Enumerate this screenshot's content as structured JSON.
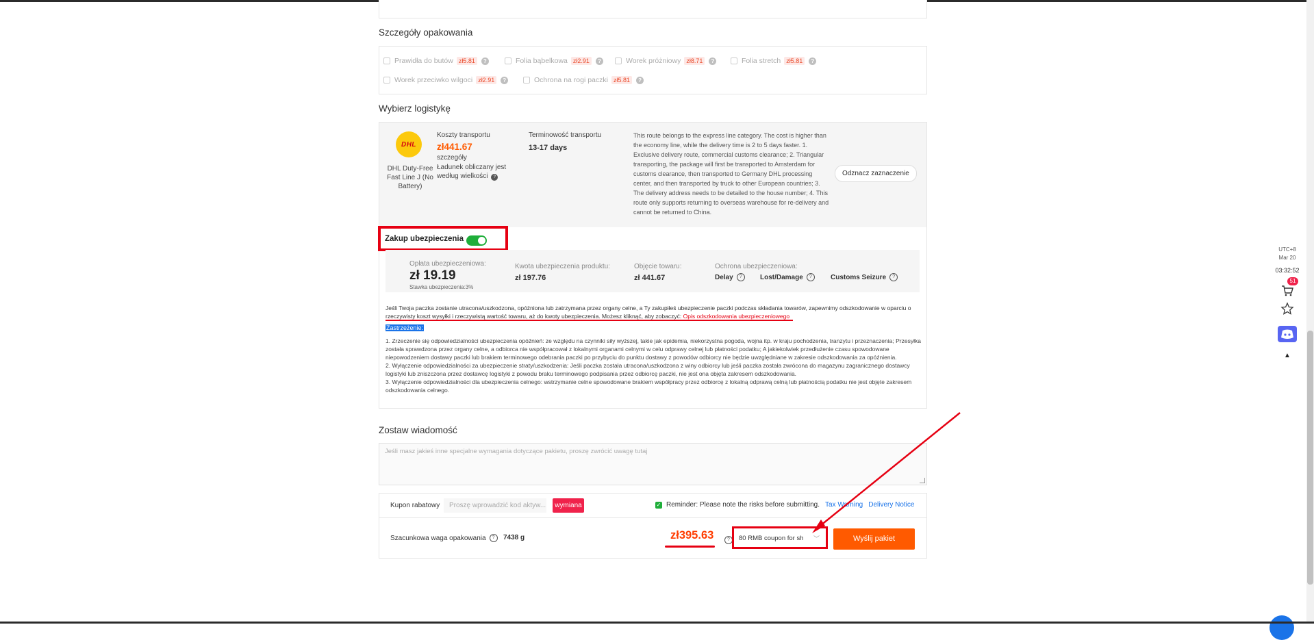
{
  "packaging": {
    "title": "Szczegóły opakowania",
    "items": [
      {
        "label": "Prawidła do butów",
        "price": "zł5.81"
      },
      {
        "label": "Folia bąbelkowa",
        "price": "zł2.91"
      },
      {
        "label": "Worek próżniowy",
        "price": "zł8.71"
      },
      {
        "label": "Folia stretch",
        "price": "zł5.81"
      },
      {
        "label": "Worek przeciwko wilgoci",
        "price": "zł2.91"
      },
      {
        "label": "Ochrona na rogi paczki",
        "price": "zł5.81"
      }
    ]
  },
  "logistics": {
    "title": "Wybierz logistykę",
    "logo_text": "DHL",
    "carrier_name": "DHL Duty-Free Fast Line J (No Battery)",
    "cost_label": "Koszty transportu",
    "cost_value": "zł441.67",
    "details_label": "szczegóły",
    "weight_note": "Ładunek obliczany jest według wielkości",
    "time_label": "Terminowość transportu",
    "time_value": "13-17 days",
    "description": "This route belongs to the express line category. The cost is higher than the economy line, while the delivery time is 2 to 5 days faster. 1. Exclusive delivery route, commercial customs clearance; 2. Triangular transporting, the package will first be transported to Amsterdam for customs clearance, then transported to Germany DHL processing center, and then transported by truck to other European countries; 3. The delivery address needs to be detailed to the house number; 4. This route only supports returning to overseas warehouse for re-delivery and cannot be returned to China.",
    "deselect_label": "Odznacz zaznaczenie"
  },
  "insurance": {
    "header": "Zakup ubezpieczenia",
    "enabled": true,
    "fee_label": "Opłata ubezpieczeniowa:",
    "fee_value": "zł 19.19",
    "rate_label": "Stawka ubezpieczenia:3%",
    "amount_label": "Kwota ubezpieczenia produktu:",
    "amount_value": "zł 197.76",
    "coverage_label": "Objęcie towaru:",
    "coverage_value": "zł 441.67",
    "protection_label": "Ochrona ubezpieczeniowa:",
    "protections": [
      "Delay",
      "Lost/Damage",
      "Customs Seizure"
    ],
    "info_text": "Jeśli Twoja paczka zostanie utracona/uszkodzona, opóźniona lub zatrzymana przez organy celne, a Ty zakupiłeś ubezpieczenie paczki podczas składania towarów, zapewnimy odszkodowanie w oparciu o rzeczywisty koszt wysyłki i rzeczywistą wartość towaru, aż do kwoty ubezpieczenia. Możesz kliknąć, aby zobaczyć:",
    "info_link": "Opis odszkodowania ubezpieczeniowego",
    "disclaimer_title": "Zastrzeżenie:",
    "disclaimers": [
      "1.  Zrzeczenie się odpowiedzialności ubezpieczenia opóźnień: ze względu na czynniki siły wyższej, takie jak epidemia, niekorzystna pogoda, wojna itp. w kraju pochodzenia, tranzytu i przeznaczenia; Przesyłka została sprawdzona przez organy celne, a odbiorca nie współpracował z lokalnymi organami celnymi w celu odprawy celnej lub płatności podatku; A jakiekolwiek przedłużenie czasu spowodowane niepowodzeniem dostawy paczki lub brakiem terminowego odebrania paczki po przybyciu do punktu dostawy z powodów odbiorcy nie będzie uwzględniane w zakresie odszkodowania za opóźnienia.",
      "2.  Wyłączenie odpowiedzialności za ubezpieczenie straty/uszkodzenia: Jeśli paczka została utracona/uszkodzona z winy odbiorcy lub jeśli paczka została zwrócona do magazynu zagranicznego dostawcy logistyki lub zniszczona przez dostawcę logistyki z powodu braku terminowego podpisania przez odbiorcę paczki, nie jest ona objęta zakresem odszkodowania.",
      "3.  Wyłączenie odpowiedzialności dla ubezpieczenia celnego: wstrzymanie celne spowodowane brakiem współpracy przez odbiorcę z lokalną odprawą celną lub płatnością podatku nie jest objęte zakresem odszkodowania celnego."
    ]
  },
  "message": {
    "title": "Zostaw wiadomość",
    "placeholder": "Jeśli masz jakieś inne specjalne wymagania dotyczące pakietu, proszę zwrócić uwagę tutaj"
  },
  "coupon": {
    "label": "Kupon rabatowy",
    "placeholder": "Proszę wprowadzić kod aktyw...",
    "exchange_label": "wymiana",
    "reminder": "Reminder: Please note the risks before submitting.",
    "tax_link": "Tax Warning",
    "delivery_link": "Delivery Notice"
  },
  "total": {
    "weight_label": "Szacunkowa waga opakowania",
    "weight_value": "7438 g",
    "price": "zł395.63",
    "coupon_select": "80 RMB coupon for sh",
    "submit_label": "Wyślij pakiet"
  },
  "side": {
    "tz": "UTC+8",
    "date": "Mar 20",
    "time": "03:32:52",
    "cart_count": "51"
  },
  "colors": {
    "accent_orange": "#ff5a00",
    "highlight_red": "#e60012",
    "toggle_green": "#1fae3a",
    "link_blue": "#1a73e8"
  }
}
